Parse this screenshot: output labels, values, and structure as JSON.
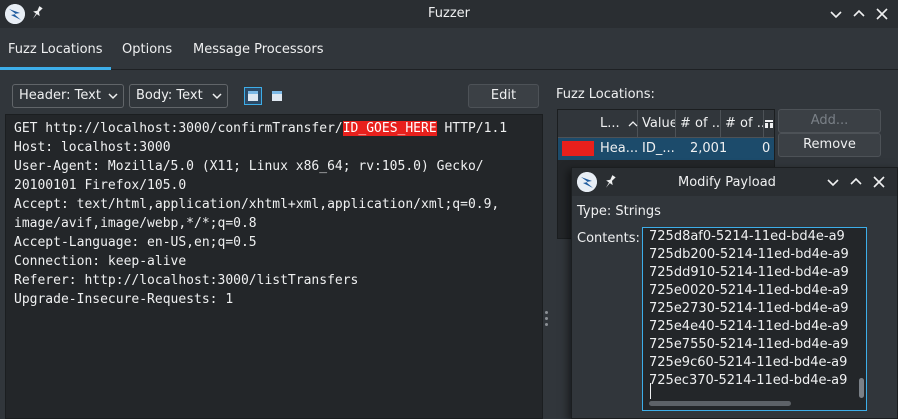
{
  "window": {
    "title": "Fuzzer"
  },
  "tabs": [
    {
      "label": "Fuzz Locations"
    },
    {
      "label": "Options"
    },
    {
      "label": "Message Processors"
    }
  ],
  "request_panel": {
    "header_combo": "Header: Text",
    "body_combo": "Body: Text",
    "edit_label": "Edit",
    "lines": [
      "GET http://localhost:3000/confirmTransfer/",
      "Host: localhost:3000",
      "User-Agent: Mozilla/5.0 (X11; Linux x86_64; rv:105.0) Gecko/",
      "20100101 Firefox/105.0",
      "Accept: text/html,application/xhtml+xml,application/xml;q=0.9,",
      "image/avif,image/webp,*/*;q=0.8",
      "Accept-Language: en-US,en;q=0.5",
      "Connection: keep-alive",
      "Referer: http://localhost:3000/listTransfers",
      "Upgrade-Insecure-Requests: 1"
    ],
    "highlight": "ID_GOES_HERE",
    "line1_suffix": " HTTP/1.1",
    "highlight_color": "#e8201c"
  },
  "fuzz_locations": {
    "label": "Fuzz Locations:",
    "columns": [
      "L...",
      "Value",
      "# of ...",
      "# of ..."
    ],
    "row": {
      "location": "Hea...",
      "value": "ID_...",
      "payloads": "2,001",
      "processors": "0"
    },
    "add_label": "Add...",
    "remove_label": "Remove"
  },
  "modify_payload": {
    "title": "Modify Payload",
    "type_label": "Type: Strings",
    "contents_label": "Contents:",
    "payloads": [
      "725d8af0-5214-11ed-bd4e-a9",
      "725db200-5214-11ed-bd4e-a9",
      "725dd910-5214-11ed-bd4e-a9",
      "725e0020-5214-11ed-bd4e-a9",
      "725e2730-5214-11ed-bd4e-a9",
      "725e4e40-5214-11ed-bd4e-a9",
      "725e7550-5214-11ed-bd4e-a9",
      "725e9c60-5214-11ed-bd4e-a9",
      "725ec370-5214-11ed-bd4e-a9"
    ]
  },
  "background": {
    "partial_label": "ssors",
    "partial_value": "0"
  },
  "colors": {
    "accent": "#3daee9",
    "selection": "#1c4b6b",
    "highlight": "#e8201c"
  }
}
